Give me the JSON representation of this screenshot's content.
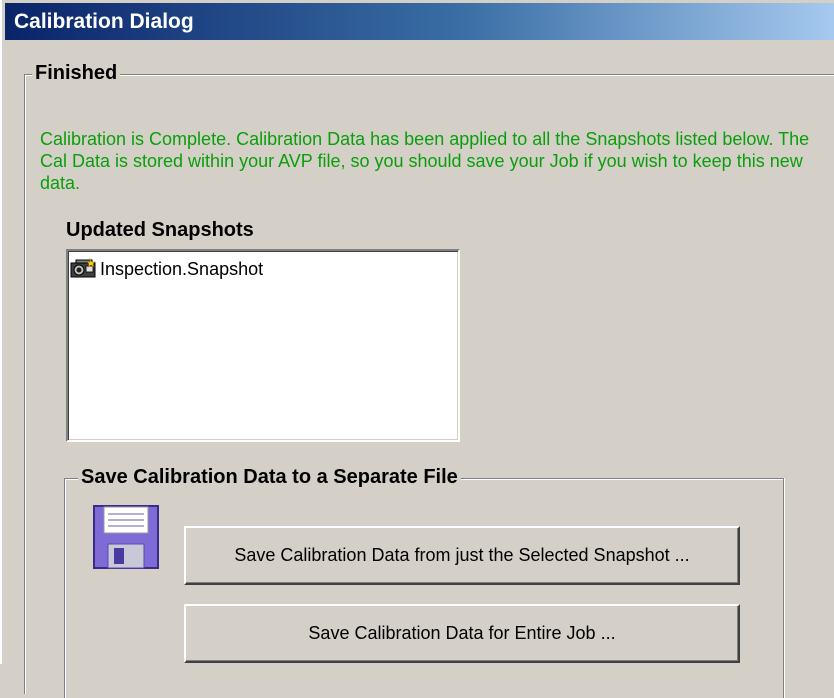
{
  "window": {
    "title": "Calibration Dialog"
  },
  "finished_group": {
    "legend": "Finished",
    "message": "Calibration is Complete.  Calibration Data has been applied to all the Snapshots listed below.  The Cal Data is stored within your AVP file, so you should save your Job if you wish to keep this new data."
  },
  "snapshots": {
    "label": "Updated Snapshots",
    "items": [
      {
        "label": "Inspection.Snapshot",
        "icon": "camera-icon"
      }
    ]
  },
  "save_group": {
    "legend": "Save Calibration Data to a Separate File",
    "icon": "floppy-disk-icon",
    "save_selected_label": "Save Calibration Data from just the Selected Snapshot ...",
    "save_job_label": "Save Calibration Data for Entire Job ..."
  },
  "colors": {
    "titlebar_start": "#0a246a",
    "titlebar_end": "#a6caf0",
    "message_text": "#0b9e0b",
    "dialog_face": "#d4d0c8"
  }
}
